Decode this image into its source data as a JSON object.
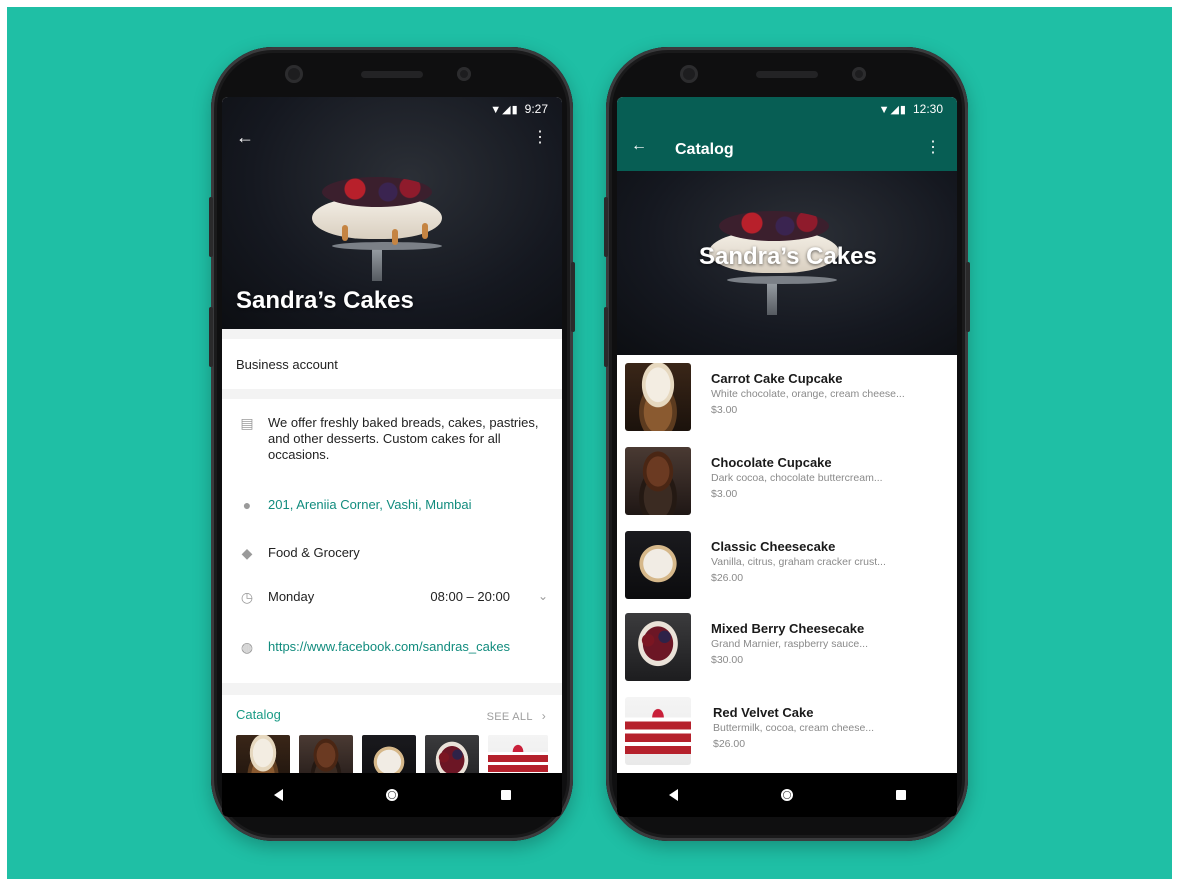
{
  "colors": {
    "background": "#1fbfa5",
    "accent": "#128c7e",
    "appbar": "#075e54"
  },
  "left_screen": {
    "status_time": "9:27",
    "business_name": "Sandra’s Cakes",
    "account_type": "Business account",
    "description": "We offer freshly baked breads, cakes, pastries, and other desserts. Custom cakes for all occasions.",
    "address": "201, Areniia Corner, Vashi, Mumbai",
    "category": "Food & Grocery",
    "hours_day": "Monday",
    "hours_time": "08:00 – 20:00",
    "website": "https://www.facebook.com/sandras_cakes",
    "catalog_title": "Catalog",
    "see_all": "SEE ALL",
    "icons": [
      "back-arrow-icon",
      "more-vert-icon",
      "store-icon",
      "location-pin-icon",
      "tag-icon",
      "clock-icon",
      "globe-icon",
      "chevron-down-icon",
      "chevron-right-icon"
    ]
  },
  "right_screen": {
    "status_time": "12:30",
    "title": "Catalog",
    "hero_title": "Sandra’s Cakes",
    "items": [
      {
        "name": "Carrot Cake Cupcake",
        "desc": "White chocolate, orange, cream cheese...",
        "price": "$3.00"
      },
      {
        "name": "Chocolate Cupcake",
        "desc": "Dark cocoa, chocolate buttercream...",
        "price": "$3.00"
      },
      {
        "name": "Classic Cheesecake",
        "desc": "Vanilla, citrus, graham cracker crust...",
        "price": "$26.00"
      },
      {
        "name": "Mixed Berry Cheesecake",
        "desc": "Grand Marnier, raspberry sauce...",
        "price": "$30.00"
      },
      {
        "name": "Red Velvet Cake",
        "desc": "Buttermilk, cocoa, cream cheese...",
        "price": "$26.00"
      }
    ]
  }
}
